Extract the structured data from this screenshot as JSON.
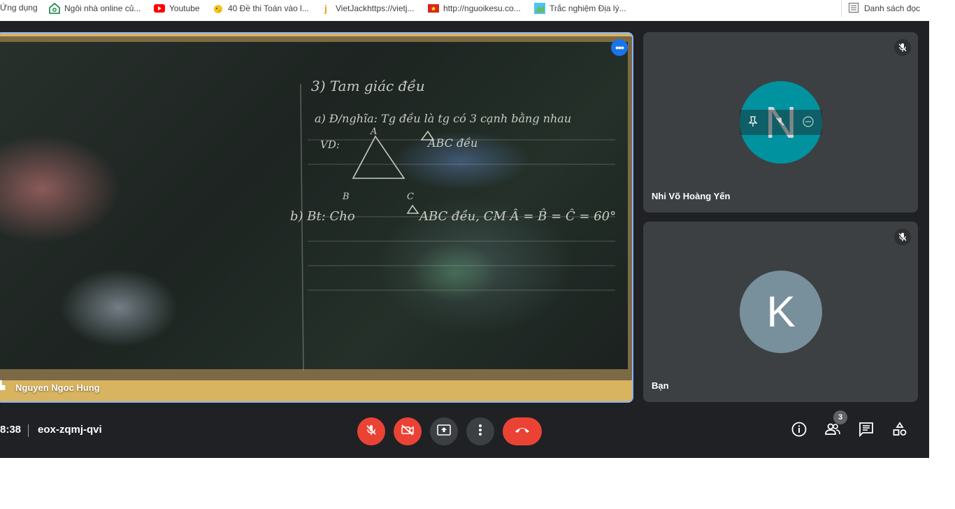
{
  "bookmarks": {
    "items": [
      {
        "label": "Ứng dụng",
        "icon": "apps-grid-icon"
      },
      {
        "label": "Ngôi nhà online củ...",
        "icon": "house-logo-icon"
      },
      {
        "label": "Youtube",
        "icon": "youtube-icon"
      },
      {
        "label": "40 Đề thi Toán vào l...",
        "icon": "chick-logo-icon"
      },
      {
        "label": "VietJackhttps://vietj...",
        "icon": "vietjack-logo-icon"
      },
      {
        "label": "http://nguoikesu.co...",
        "icon": "vietnam-flag-icon"
      },
      {
        "label": "Trắc nghiệm Địa lý...",
        "icon": "map-quiz-icon"
      }
    ],
    "reading_list": "Danh sách đọc"
  },
  "main_tile": {
    "name": "Nguyen Ngoc Hung",
    "more_label": "•••"
  },
  "participants": [
    {
      "name": "Nhi Võ Hoàng Yến",
      "initial": "N",
      "muted": true,
      "color": "#00929f"
    },
    {
      "name": "Bạn",
      "initial": "K",
      "muted": true,
      "color": "#78909c"
    }
  ],
  "footer": {
    "time": "8:38",
    "meeting_code": "eox-zqmj-qvi",
    "people_count": "3"
  },
  "colors": {
    "background": "#202124",
    "tile": "#3c4043",
    "danger": "#ea4335",
    "active_border": "#8ab4f8"
  }
}
